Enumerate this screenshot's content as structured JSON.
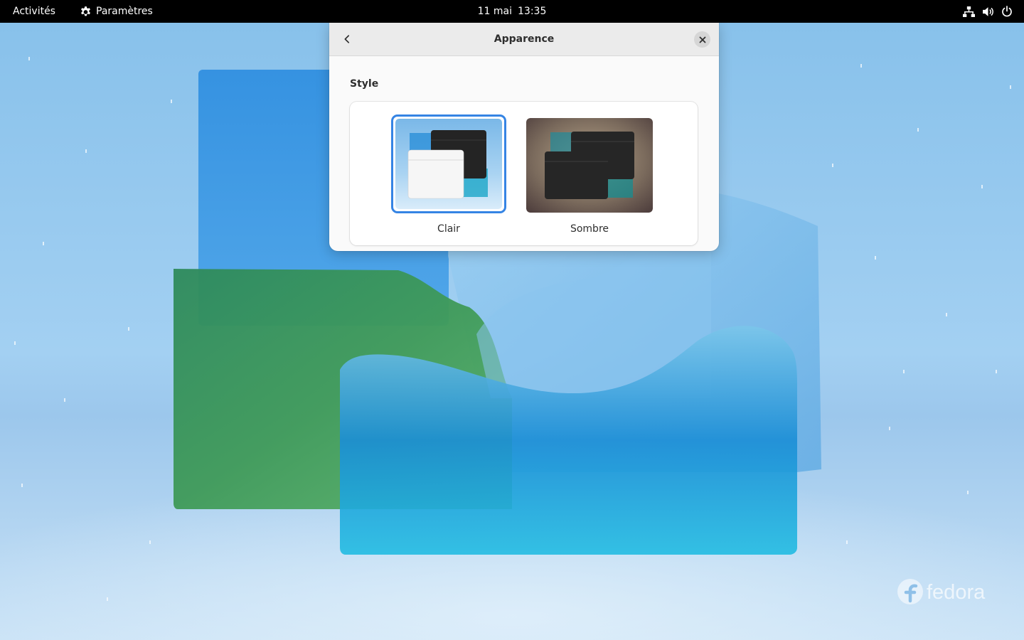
{
  "topbar": {
    "activities": "Activités",
    "app_name": "Paramètres",
    "date": "11 mai",
    "time": "13:35",
    "tray_icons": [
      "network-wired-icon",
      "volume-icon",
      "power-icon"
    ]
  },
  "dialog": {
    "title": "Apparence",
    "section_heading": "Style",
    "options": [
      {
        "label": "Clair",
        "selected": true,
        "icon": "light-style-preview"
      },
      {
        "label": "Sombre",
        "selected": false,
        "icon": "dark-style-preview"
      }
    ]
  },
  "desktop": {
    "logo_text": "fedora"
  },
  "colors": {
    "accent": "#3584e4",
    "topbar_bg": "#000000",
    "dialog_bg": "#fafafa",
    "header_bg": "#ebebeb"
  }
}
